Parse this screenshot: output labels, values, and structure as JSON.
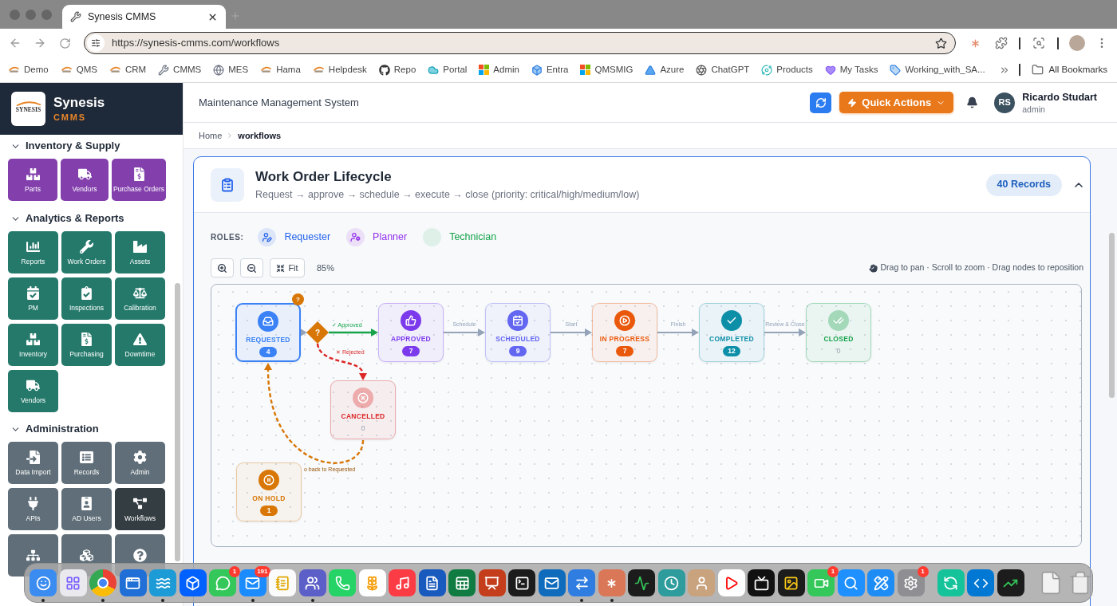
{
  "browser": {
    "tab": {
      "title": "Synesis CMMS"
    },
    "url": "https://synesis-cmms.com/workflows",
    "bookmarks": [
      {
        "label": "Demo"
      },
      {
        "label": "QMS"
      },
      {
        "label": "CRM"
      },
      {
        "label": "CMMS"
      },
      {
        "label": "MES"
      },
      {
        "label": "Hama"
      },
      {
        "label": "Helpdesk"
      },
      {
        "label": "Repo"
      },
      {
        "label": "Portal"
      },
      {
        "label": "Admin"
      },
      {
        "label": "Entra"
      },
      {
        "label": "QMSMIG"
      },
      {
        "label": "Azure"
      },
      {
        "label": "ChatGPT"
      },
      {
        "label": "Products"
      },
      {
        "label": "My Tasks"
      },
      {
        "label": "Working_with_SA..."
      }
    ],
    "all_bookmarks": "All Bookmarks"
  },
  "sidebar": {
    "brand": {
      "logo_word": "SYNESIS",
      "name": "Synesis",
      "product": "CMMS"
    },
    "sections": [
      {
        "title": "Inventory & Supply",
        "expanded": true,
        "color": "#8340ad",
        "items": [
          {
            "label": "Parts",
            "selected": false
          },
          {
            "label": "Vendors",
            "selected": false
          },
          {
            "label": "Purchase Orders",
            "selected": false
          }
        ]
      },
      {
        "title": "Analytics & Reports",
        "expanded": true,
        "color": "#24796b",
        "items": [
          {
            "label": "Reports",
            "selected": false
          },
          {
            "label": "Work Orders",
            "selected": false
          },
          {
            "label": "Assets",
            "selected": false
          },
          {
            "label": "PM",
            "selected": false
          },
          {
            "label": "Inspections",
            "selected": false
          },
          {
            "label": "Calibration",
            "selected": false
          },
          {
            "label": "Inventory",
            "selected": false
          },
          {
            "label": "Purchasing",
            "selected": false
          },
          {
            "label": "Downtime",
            "selected": false
          },
          {
            "label": "Vendors",
            "selected": false
          }
        ]
      },
      {
        "title": "Administration",
        "expanded": true,
        "color": "#5f6e78",
        "items": [
          {
            "label": "Data Import",
            "selected": false
          },
          {
            "label": "Records",
            "selected": false
          },
          {
            "label": "Admin",
            "selected": false
          },
          {
            "label": "APIs",
            "selected": false
          },
          {
            "label": "AD Users",
            "selected": false
          },
          {
            "label": "Workflows",
            "selected": true
          },
          {
            "selected": false
          },
          {
            "selected": false
          },
          {
            "selected": false
          }
        ]
      }
    ]
  },
  "header": {
    "title": "Maintenance Management System",
    "quick_actions": "Quick Actions",
    "user": {
      "initials": "RS",
      "name": "Ricardo Studart",
      "role": "admin"
    }
  },
  "breadcrumb": [
    {
      "label": "Home",
      "current": false
    },
    {
      "label": "workflows",
      "current": true
    }
  ],
  "workflow": {
    "title": "Work Order Lifecycle",
    "subtitle": "Request → approve → schedule → execute → close (priority: critical/high/medium/low)",
    "records": "40 Records",
    "expanded": true,
    "roles_label": "ROLES:",
    "roles": [
      {
        "name": "Requester",
        "color": "#2563eb",
        "kind": "icon"
      },
      {
        "name": "Planner",
        "color": "#9333ea",
        "kind": "icon"
      },
      {
        "name": "Technician",
        "color": "#16a34a",
        "kind": "empty"
      }
    ],
    "fit_label": "Fit",
    "zoom_level": "85%",
    "hint": "Drag to pan · Scroll to zoom · Drag nodes to reposition",
    "decision": "?",
    "nodes": [
      {
        "label": "REQUESTED",
        "count": "4",
        "color": "#3b82f6",
        "selected": true,
        "faded": false,
        "flag": "?"
      },
      {
        "label": "APPROVED",
        "count": "7",
        "color": "#7c3aed",
        "selected": false,
        "faded": false
      },
      {
        "label": "SCHEDULED",
        "count": "9",
        "color": "#6366f1",
        "selected": false,
        "faded": false
      },
      {
        "label": "IN PROGRESS",
        "count": "7",
        "color": "#ea580c",
        "selected": false,
        "faded": false
      },
      {
        "label": "COMPLETED",
        "count": "12",
        "color": "#0e8fa8",
        "selected": false,
        "faded": false
      },
      {
        "label": "CLOSED",
        "count": "0",
        "color": "#16a34a",
        "selected": false,
        "faded": true
      },
      {
        "label": "CANCELLED",
        "count": "0",
        "color": "#dc2626",
        "selected": false,
        "faded": true
      },
      {
        "label": "ON HOLD",
        "count": "1",
        "color": "#d97706",
        "selected": false,
        "faded": false
      }
    ],
    "edges": [
      {
        "color": "#94a3b8",
        "kind": "solid"
      },
      {
        "label": "✓ Approved",
        "color": "#16a34a",
        "kind": "solid"
      },
      {
        "label": "Schedule",
        "color": "#94a3b8",
        "kind": "solid"
      },
      {
        "label": "Start",
        "color": "#94a3b8",
        "kind": "solid"
      },
      {
        "label": "Finish",
        "color": "#94a3b8",
        "kind": "solid"
      },
      {
        "label": "Review & Close",
        "color": "#94a3b8",
        "kind": "solid"
      },
      {
        "label": "✕ Rejected",
        "color": "#dc2626",
        "kind": "dashed"
      },
      {
        "label": "o back to Requested",
        "color": "#d97706",
        "kind": "dashed"
      }
    ]
  },
  "dock": {
    "groups": [
      {
        "apps": [
          {
            "running": true
          },
          {
            "running": false
          },
          {
            "running": true
          },
          {
            "running": false
          },
          {
            "running": true
          },
          {
            "running": false
          },
          {
            "running": false,
            "badge": "1"
          },
          {
            "running": true,
            "badge": "191"
          },
          {
            "running": false
          },
          {
            "running": true
          },
          {
            "running": false
          },
          {
            "running": false
          },
          {
            "running": false
          },
          {
            "running": false
          },
          {
            "running": false
          },
          {
            "running": false
          },
          {
            "running": false
          },
          {
            "running": false
          },
          {
            "running": true
          },
          {
            "running": true
          },
          {
            "running": false
          },
          {
            "running": false
          },
          {
            "running": false
          },
          {
            "running": false
          },
          {
            "running": false
          },
          {
            "running": false
          },
          {
            "running": false,
            "badge": "1"
          },
          {
            "running": false
          },
          {
            "running": false
          },
          {
            "running": false,
            "badge": "1"
          }
        ]
      },
      {
        "apps": [
          {
            "running": false
          },
          {
            "running": false
          },
          {
            "running": false
          }
        ]
      },
      {
        "apps": [
          {
            "running": false
          },
          {
            "running": false
          }
        ]
      }
    ]
  }
}
